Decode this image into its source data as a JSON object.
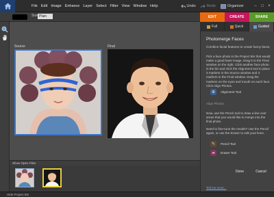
{
  "menu": [
    "File",
    "Edit",
    "Image",
    "Enhance",
    "Layer",
    "Select",
    "Filter",
    "View",
    "Window",
    "Help"
  ],
  "top_right": {
    "undo": "Undo",
    "redo": "Redo",
    "organizer": "Organizer"
  },
  "options": {
    "size_label": "Size:",
    "size_value": "Plain"
  },
  "canvas": {
    "source_label": "Source",
    "final_label": "Final"
  },
  "bin": {
    "show_open_files": "Show Open Files"
  },
  "status": {
    "hide_bin": "Hide Project Bin"
  },
  "panel": {
    "tabs": [
      "EDIT",
      "CREATE",
      "SHARE"
    ],
    "subtabs": [
      "Full",
      "Quick",
      "Guided"
    ],
    "title": "Photomerge Faces",
    "intro": "Combine facial features to create funny faces.",
    "instructions": "Pick a face photo in the Project Bin that would make a good base image. Drag it to the Final window on the right. Click another face photo in the bin and click the Alignment tool to place 3 markers in the Source window and 3 markers in the Final window. Drag the markers on the eyes and mouth on each face. Click Align Photos.",
    "alignment_tool": "Alignment Tool",
    "align_photos": "Align Photos",
    "pencil_instructions": "Now, use the Pencil tool to draw a line over areas that you would like to merge into the final photo.",
    "finetune_instructions": "Need to fine-tune the results? Use the Pencil again, or use the Eraser to edit your lines.",
    "pencil_tool": "Pencil Tool",
    "eraser_tool": "Eraser Tool",
    "done": "Done",
    "cancel": "Cancel",
    "tell_me_more": "Tell me more..."
  },
  "colors": {
    "edit_tab": "#e86a10",
    "create_tab": "#c2185b",
    "share_tab": "#5a9a2a",
    "selection": "#3b74c8"
  }
}
